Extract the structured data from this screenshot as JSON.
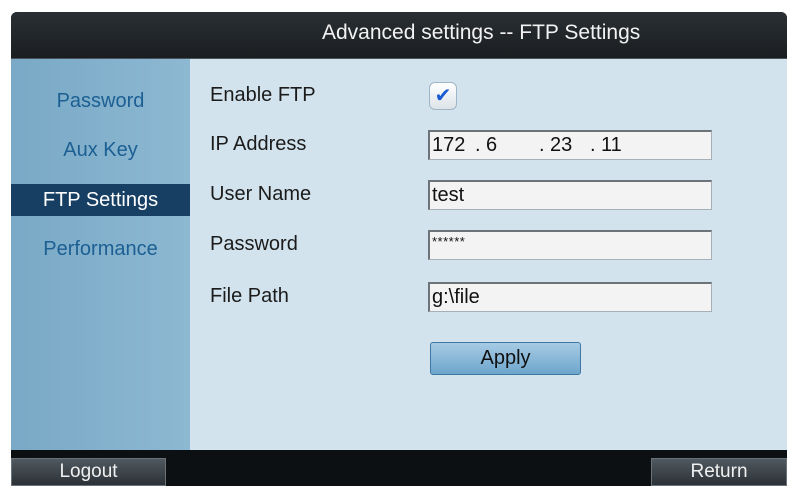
{
  "window": {
    "title": "Advanced settings -- FTP Settings"
  },
  "sidebar": {
    "items": [
      {
        "label": "Password",
        "active": false
      },
      {
        "label": "Aux Key",
        "active": false
      },
      {
        "label": "FTP Settings",
        "active": true
      },
      {
        "label": "Performance",
        "active": false
      }
    ]
  },
  "form": {
    "enable_ftp": {
      "label": "Enable FTP",
      "checked": true,
      "check_glyph": "✔"
    },
    "ip_address": {
      "label": "IP Address",
      "octets": [
        "172",
        "6",
        "23",
        "11"
      ],
      "separator": "."
    },
    "user_name": {
      "label": "User Name",
      "value": "test"
    },
    "password": {
      "label": "Password",
      "value": "******"
    },
    "file_path": {
      "label": "File Path",
      "value": "g:\\file"
    },
    "apply_label": "Apply"
  },
  "footer": {
    "logout_label": "Logout",
    "return_label": "Return"
  },
  "colors": {
    "title_bar": "#1d2226",
    "sidebar": "#8db8d2",
    "sidebar_active": "#163f63",
    "sidebar_text": "#1c5f93",
    "content_bg": "#d2e3ed",
    "check_accent": "#1b5bd0",
    "apply_button": "#8fbbdb"
  }
}
